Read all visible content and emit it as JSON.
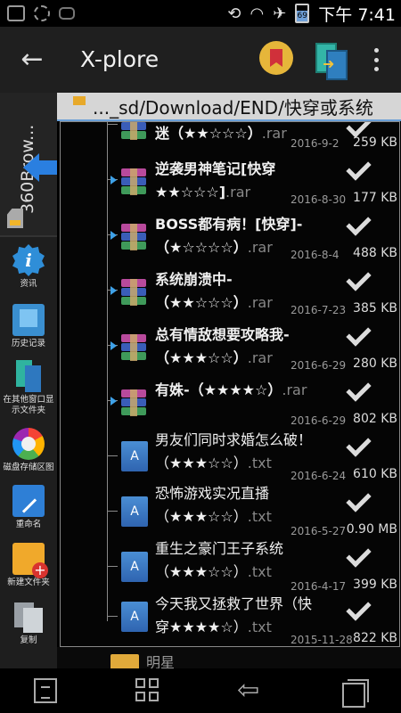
{
  "status_bar": {
    "time": "下午 7:41",
    "battery": "69"
  },
  "app_bar": {
    "title": "X-plore",
    "back_icon": "arrow-left-icon",
    "bookmark_icon": "bookmark-icon",
    "dual_pane_icon": "dual-pane-icon",
    "menu_icon": "overflow-menu-icon"
  },
  "sidebar": {
    "tab_label": "360Brow...",
    "tools": [
      {
        "label": "资讯",
        "icon": "info-icon"
      },
      {
        "label": "历史记录",
        "icon": "history-icon"
      },
      {
        "label": "在其他窗口显示文件夹",
        "icon": "show-in-other-pane-icon"
      },
      {
        "label": "磁盘存储区图",
        "icon": "disk-map-icon"
      },
      {
        "label": "重命名",
        "icon": "rename-icon"
      },
      {
        "label": "新建文件夹",
        "icon": "new-folder-icon"
      },
      {
        "label": "复制",
        "icon": "copy-icon"
      }
    ]
  },
  "path": {
    "text": "..._sd/Download/END/快穿或系统"
  },
  "files": [
    {
      "name": "迷（★★☆☆☆）",
      "ext": ".rar",
      "date": "2016-9-2",
      "size": "259 KB",
      "type": "rar"
    },
    {
      "name": "逆袭男神笔记[快穿★★☆☆☆]",
      "ext": ".rar",
      "date": "2016-8-30",
      "size": "177 KB",
      "type": "rar"
    },
    {
      "name": "BOSS都有病！[快穿]-（★☆☆☆☆）",
      "ext": ".rar",
      "date": "2016-8-4",
      "size": "488 KB",
      "type": "rar"
    },
    {
      "name": "系统崩溃中-（★★☆☆☆）",
      "ext": ".rar",
      "date": "2016-7-23",
      "size": "385 KB",
      "type": "rar"
    },
    {
      "name": "总有情敌想要攻略我-（★★★☆☆）",
      "ext": ".rar",
      "date": "2016-6-29",
      "size": "280 KB",
      "type": "rar"
    },
    {
      "name": "有姝-（★★★★☆）",
      "ext": ".rar",
      "date": "2016-6-29",
      "size": "802 KB",
      "type": "rar"
    },
    {
      "name": "男友们同时求婚怎么破！（★★★☆☆）",
      "ext": ".txt",
      "date": "2016-6-24",
      "size": "610 KB",
      "type": "txt"
    },
    {
      "name": "恐怖游戏实况直播（★★★☆☆）",
      "ext": ".txt",
      "date": "2016-5-27",
      "size": "0.90 MB",
      "type": "txt"
    },
    {
      "name": "重生之豪门王子系统（★★★☆☆）",
      "ext": ".txt",
      "date": "2016-4-17",
      "size": "399 KB",
      "type": "txt"
    },
    {
      "name": "今天我又拯救了世界（快穿★★★★☆）",
      "ext": ".txt",
      "date": "2015-11-28",
      "size": "822 KB",
      "type": "txt"
    }
  ],
  "next_folder": "明星",
  "nav_bar": {
    "menu_icon": "menu-icon",
    "home_icon": "home-icon",
    "back_icon": "back-icon",
    "recent_icon": "recent-apps-icon"
  }
}
